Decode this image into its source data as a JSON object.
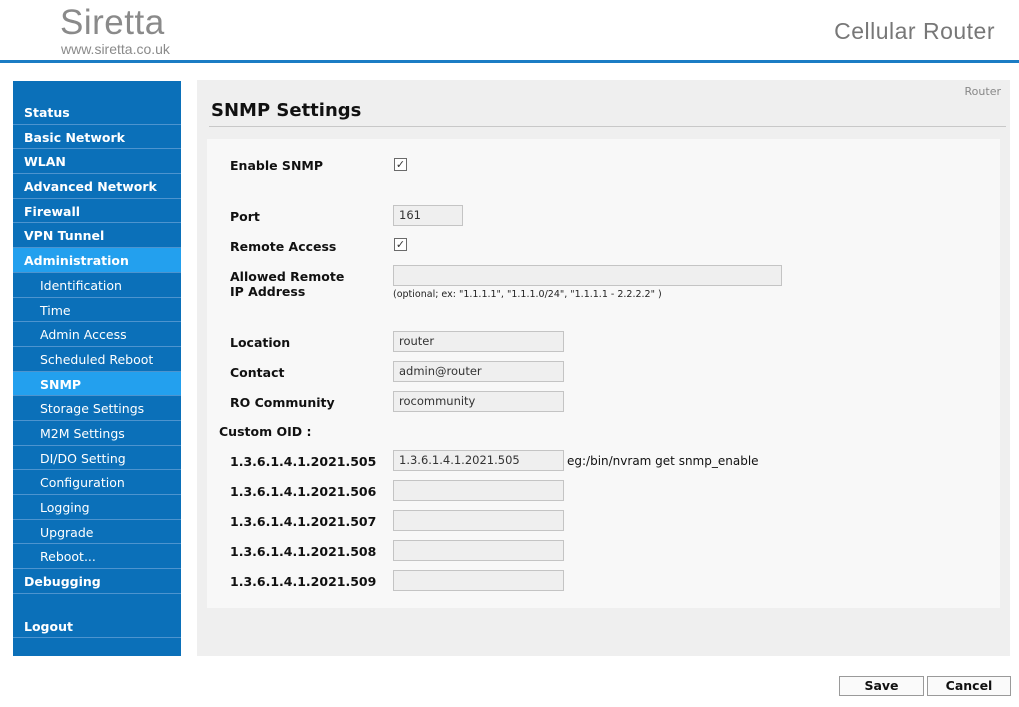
{
  "brand": {
    "name": "Siretta",
    "url": "www.siretta.co.uk"
  },
  "product": "Cellular Router",
  "breadcrumb": "Router",
  "page_title": "SNMP Settings",
  "nav": [
    {
      "label": "Status",
      "level": "top"
    },
    {
      "label": "Basic Network",
      "level": "top"
    },
    {
      "label": "WLAN",
      "level": "top"
    },
    {
      "label": "Advanced Network",
      "level": "top"
    },
    {
      "label": "Firewall",
      "level": "top"
    },
    {
      "label": "VPN Tunnel",
      "level": "top"
    },
    {
      "label": "Administration",
      "level": "top",
      "active": true
    },
    {
      "label": "Identification",
      "level": "sub"
    },
    {
      "label": "Time",
      "level": "sub"
    },
    {
      "label": "Admin Access",
      "level": "sub"
    },
    {
      "label": "Scheduled Reboot",
      "level": "sub"
    },
    {
      "label": "SNMP",
      "level": "sub",
      "active": true,
      "bold": true
    },
    {
      "label": "Storage Settings",
      "level": "sub"
    },
    {
      "label": "M2M Settings",
      "level": "sub"
    },
    {
      "label": "DI/DO Setting",
      "level": "sub"
    },
    {
      "label": "Configuration",
      "level": "sub"
    },
    {
      "label": "Logging",
      "level": "sub"
    },
    {
      "label": "Upgrade",
      "level": "sub"
    },
    {
      "label": "Reboot...",
      "level": "sub"
    },
    {
      "label": "Debugging",
      "level": "top"
    }
  ],
  "logout_label": "Logout",
  "form": {
    "enable_snmp": {
      "label": "Enable SNMP",
      "checked": true
    },
    "port": {
      "label": "Port",
      "value": "161"
    },
    "remote_access": {
      "label": "Remote Access",
      "checked": true
    },
    "allowed_remote": {
      "label_line1": "Allowed Remote",
      "label_line2": "IP Address",
      "value": "",
      "hint": "(optional; ex: \"1.1.1.1\", \"1.1.1.0/24\", \"1.1.1.1 - 2.2.2.2\" )"
    },
    "location": {
      "label": "Location",
      "value": "router"
    },
    "contact": {
      "label": "Contact",
      "value": "admin@router"
    },
    "ro_community": {
      "label": "RO Community",
      "value": "rocommunity"
    },
    "custom_oid_label": "Custom OID :",
    "oids": [
      {
        "label": "1.3.6.1.4.1.2021.505",
        "value": "1.3.6.1.4.1.2021.505",
        "example": "eg:/bin/nvram get snmp_enable"
      },
      {
        "label": "1.3.6.1.4.1.2021.506",
        "value": ""
      },
      {
        "label": "1.3.6.1.4.1.2021.507",
        "value": ""
      },
      {
        "label": "1.3.6.1.4.1.2021.508",
        "value": ""
      },
      {
        "label": "1.3.6.1.4.1.2021.509",
        "value": ""
      }
    ]
  },
  "buttons": {
    "save": "Save",
    "cancel": "Cancel"
  },
  "colors": {
    "nav_bg": "#0b70b9",
    "nav_active": "#23a0ee",
    "header_rule": "#1b7cc4"
  }
}
